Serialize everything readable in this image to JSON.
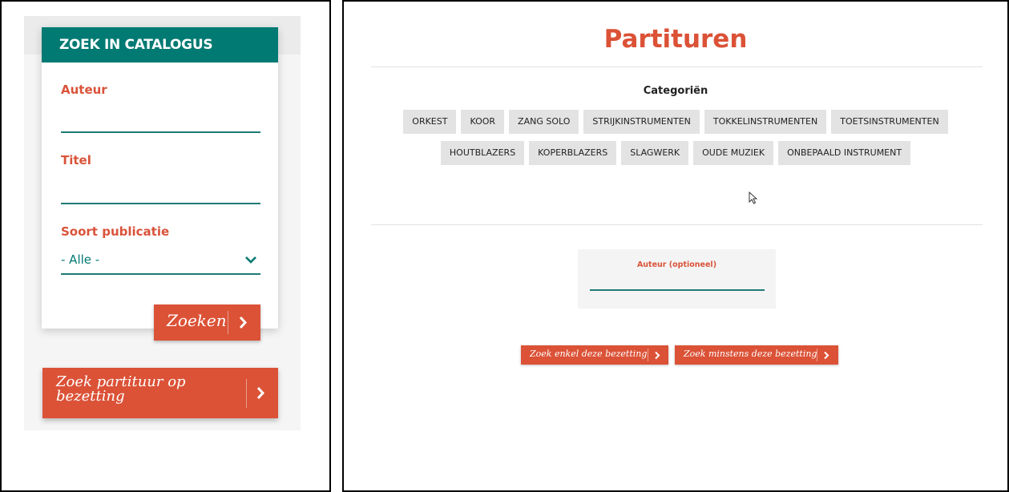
{
  "sidebar": {
    "header": "ZOEK IN CATALOGUS",
    "author_label": "Auteur",
    "title_label": "Titel",
    "pubtype_label": "Soort publicatie",
    "pubtype_value": "- Alle -",
    "search_button": "Zoeken",
    "bezetting_button": "Zoek partituur op bezetting"
  },
  "main": {
    "title": "Partituren",
    "categories_title": "Categoriën",
    "categories_row1": [
      "ORKEST",
      "KOOR",
      "ZANG SOLO",
      "STRIJKINSTRUMENTEN",
      "TOKKELINSTRUMENTEN",
      "TOETSINSTRUMENTEN"
    ],
    "categories_row2": [
      "HOUTBLAZERS",
      "KOPERBLAZERS",
      "SLAGWERK",
      "OUDE MUZIEK",
      "ONBEPAALD INSTRUMENT"
    ],
    "author_optional_label": "Auteur (optioneel)",
    "exact_button": "Zoek enkel deze bezetting",
    "min_button": "Zoek minstens deze bezetting"
  },
  "colors": {
    "accent": "#db5237",
    "teal": "#007a72",
    "category_bg": "#e3e3e3"
  }
}
